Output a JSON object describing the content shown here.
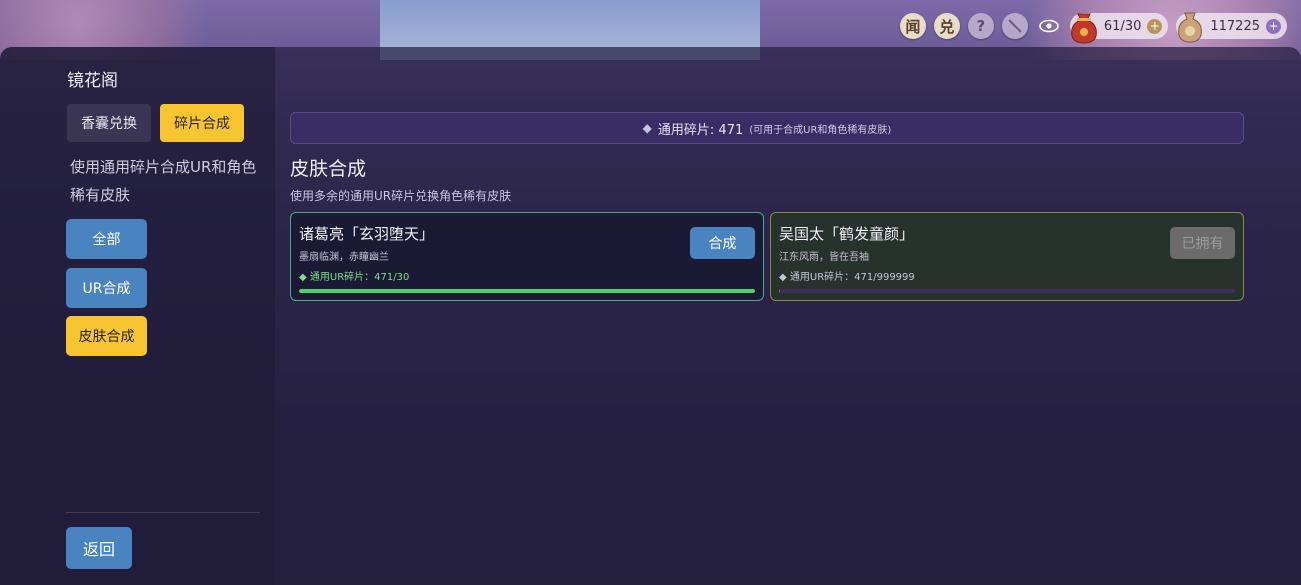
{
  "topbar": {
    "btn_wen": "闻",
    "btn_dui": "兑",
    "btn_help": "?",
    "btn_mute_icon": "no-sound-icon",
    "eye_icon": "eye-icon",
    "resource1": {
      "icon": "money-bag-icon",
      "value": "61/30",
      "plus": "+",
      "plus_color": "#b9955a"
    },
    "resource2": {
      "icon": "coin-pouch-icon",
      "value": "117225",
      "plus": "+",
      "plus_color": "#8e6fc2"
    }
  },
  "sidebar": {
    "title": "镜花阁",
    "tabs": [
      {
        "label": "香囊兑换",
        "active": false
      },
      {
        "label": "碎片合成",
        "active": true
      }
    ],
    "description": "使用通用碎片合成UR和角色稀有皮肤",
    "filters": [
      {
        "label": "全部",
        "color": "blue"
      },
      {
        "label": "UR合成",
        "color": "blue"
      },
      {
        "label": "皮肤合成",
        "color": "gold"
      }
    ],
    "back_label": "返回"
  },
  "main": {
    "info_bar": {
      "text": "通用碎片: 471",
      "note": "(可用于合成UR和角色稀有皮肤)"
    },
    "section_title": "皮肤合成",
    "section_subtitle": "使用多余的通用UR碎片兑换角色稀有皮肤",
    "cards": [
      {
        "name": "诸葛亮「玄羽堕天」",
        "desc": "墨扇临渊，赤瞳幽兰",
        "fragments": "◆ 通用UR碎片：471/30",
        "progress": 1.0,
        "button": "合成",
        "button_state": "enabled"
      },
      {
        "name": "吴国太「鹤发童颜」",
        "desc": "江东风雨，皆在吾袖",
        "fragments": "◆ 通用UR碎片：471/999999",
        "progress": 0.0005,
        "button": "已拥有",
        "button_state": "disabled"
      }
    ]
  },
  "colors": {
    "accent_gold": "#f7c531",
    "accent_blue": "#4a84c0",
    "progress_green": "#4fd06a"
  }
}
